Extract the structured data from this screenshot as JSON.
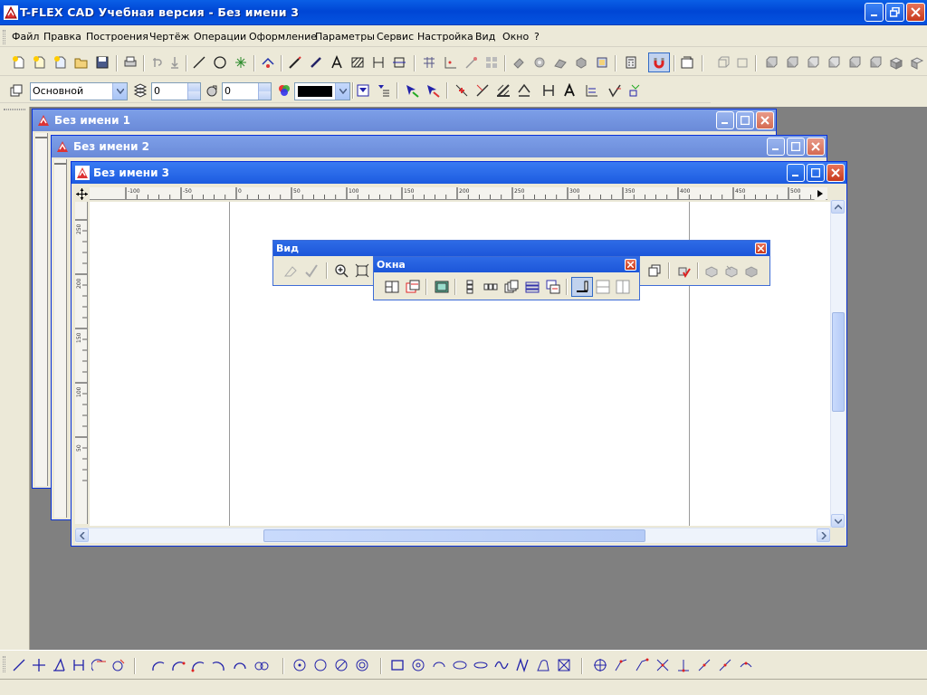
{
  "app": {
    "title": "T-FLEX CAD Учебная версия - Без имени 3"
  },
  "menu": {
    "items": [
      {
        "label": "Файл"
      },
      {
        "label": "Правка"
      },
      {
        "label": "Построения"
      },
      {
        "label": "Чертёж"
      },
      {
        "label": "Операции"
      },
      {
        "label": "Оформление"
      },
      {
        "label": "Параметры"
      },
      {
        "label": "Сервис"
      },
      {
        "label": "Настройка"
      },
      {
        "label": "Вид"
      },
      {
        "label": "Окно"
      },
      {
        "label": "?"
      }
    ]
  },
  "props_toolbar": {
    "layer_value": "Основной",
    "level_value": "0",
    "priority_value": "0"
  },
  "windows": [
    {
      "title": "Без имени 1"
    },
    {
      "title": "Без имени 2"
    },
    {
      "title": "Без имени 3"
    }
  ],
  "ruler": {
    "h_ticks": [
      "-100",
      "-50",
      "0",
      "50",
      "100",
      "150",
      "200",
      "250",
      "300",
      "350",
      "400",
      "450",
      "500"
    ],
    "v_ticks": [
      "250",
      "200",
      "150",
      "100",
      "50"
    ]
  },
  "panels": {
    "view_title": "Вид",
    "windows_title": "Окна"
  },
  "colors": {
    "title_blue": "#0A5FE6",
    "mdi_gray": "#808080",
    "xp_face": "#ECE9D8",
    "close_red": "#C7391C"
  }
}
